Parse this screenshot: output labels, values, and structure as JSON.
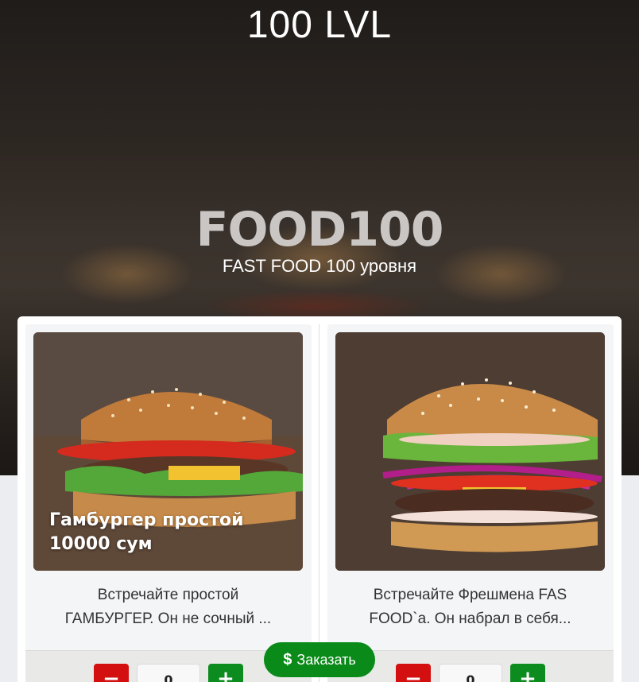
{
  "header": {
    "brand": "100 LVL",
    "title": "FOOD100",
    "subtitle": "FAST FOOD 100 уровня"
  },
  "products": [
    {
      "caption_line1": "Гамбургер простой",
      "caption_line2": "10000 сум",
      "description_line1": "Встречайте простой",
      "description_line2": "ГАМБУРГЕР. Он не сочный ...",
      "quantity": "0",
      "minus_label": "−",
      "plus_label": "+"
    },
    {
      "caption_line1": "",
      "caption_line2": "",
      "description_line1": "Встречайте Фрешмена FAS",
      "description_line2": "FOOD`а. Он набрал в себя...",
      "quantity": "0",
      "minus_label": "−",
      "plus_label": "+"
    }
  ],
  "order_button": {
    "icon": "$",
    "label": "Заказать"
  },
  "colors": {
    "minus": "#d30f0f",
    "plus": "#0c8c1e",
    "order": "#0a8a18"
  }
}
